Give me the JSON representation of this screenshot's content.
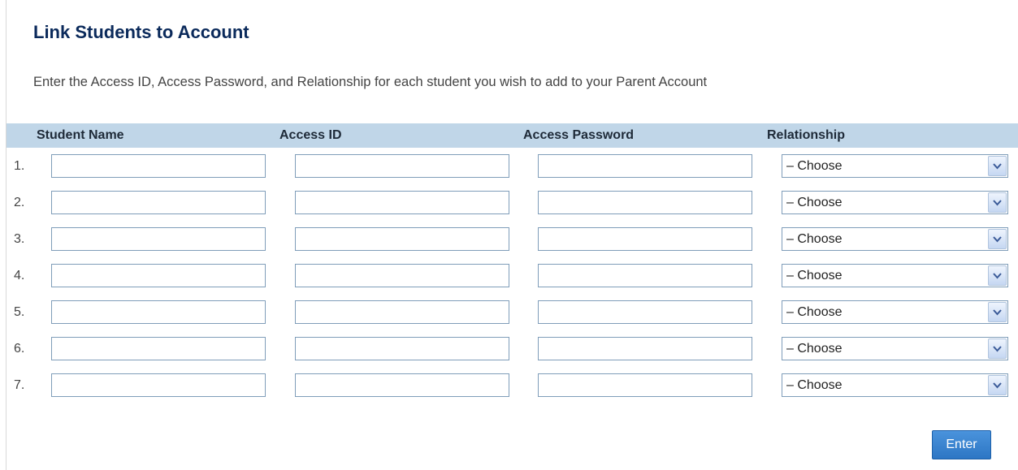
{
  "page": {
    "title": "Link Students to Account",
    "instructions": "Enter the Access ID, Access Password, and Relationship for each student you wish to add to your Parent Account"
  },
  "table": {
    "columns": [
      "Student Name",
      "Access ID",
      "Access Password",
      "Relationship"
    ],
    "rows": [
      {
        "number": "1.",
        "student_name": "",
        "access_id": "",
        "access_password": "",
        "relationship": "– Choose"
      },
      {
        "number": "2.",
        "student_name": "",
        "access_id": "",
        "access_password": "",
        "relationship": "– Choose"
      },
      {
        "number": "3.",
        "student_name": "",
        "access_id": "",
        "access_password": "",
        "relationship": "– Choose"
      },
      {
        "number": "4.",
        "student_name": "",
        "access_id": "",
        "access_password": "",
        "relationship": "– Choose"
      },
      {
        "number": "5.",
        "student_name": "",
        "access_id": "",
        "access_password": "",
        "relationship": "– Choose"
      },
      {
        "number": "6.",
        "student_name": "",
        "access_id": "",
        "access_password": "",
        "relationship": "– Choose"
      },
      {
        "number": "7.",
        "student_name": "",
        "access_id": "",
        "access_password": "",
        "relationship": "– Choose"
      }
    ]
  },
  "actions": {
    "submit_label": "Enter"
  },
  "icons": {
    "dropdown": "chevron-down-icon"
  },
  "colors": {
    "title": "#0b2a5b",
    "header_bar": "#c0d6e8",
    "field_border": "#7f9db9",
    "button": "#2d76c4"
  }
}
